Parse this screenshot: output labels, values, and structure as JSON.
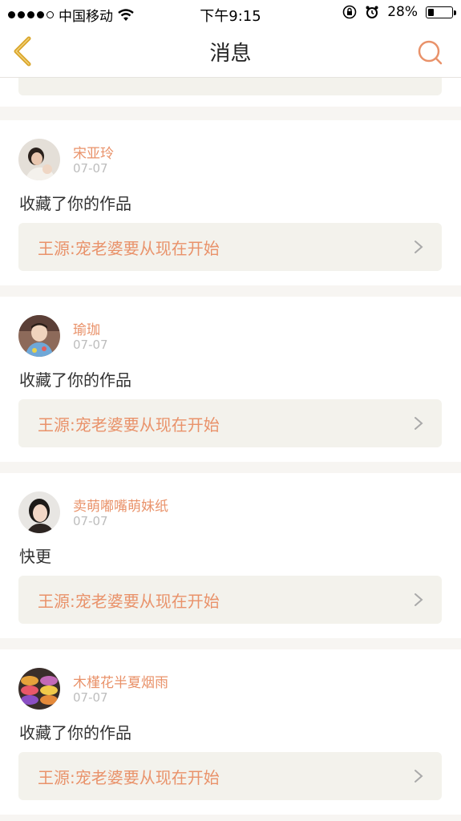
{
  "status_bar": {
    "carrier": "中国移动",
    "time": "下午9:15",
    "battery": "28%",
    "battery_level": 0.28
  },
  "nav": {
    "title": "消息",
    "back_icon": "chevron-left-icon",
    "search_icon": "search-icon"
  },
  "colors": {
    "accent": "#e9926a",
    "back_icon": "#d9a52a",
    "card_bg": "#f3f2ec",
    "date": "#bdbdbd"
  },
  "messages": [
    {
      "user": "宋亚玲",
      "date": "07-07",
      "text": "收藏了你的作品",
      "work": "王源:宠老婆要从现在开始"
    },
    {
      "user": "瑜珈",
      "date": "07-07",
      "text": "收藏了你的作品",
      "work": "王源:宠老婆要从现在开始"
    },
    {
      "user": "卖萌嘟嘴萌妹纸",
      "date": "07-07",
      "text": "快更",
      "work": "王源:宠老婆要从现在开始"
    },
    {
      "user": "木槿花半夏烟雨",
      "date": "07-07",
      "text": "收藏了你的作品",
      "work": "王源:宠老婆要从现在开始"
    }
  ]
}
